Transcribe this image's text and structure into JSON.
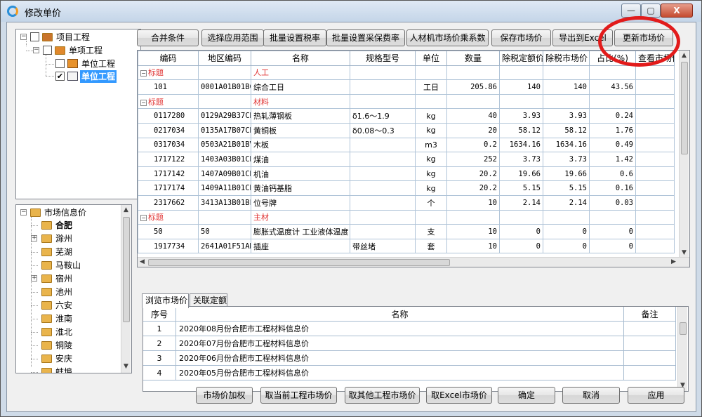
{
  "window": {
    "title": "修改单价",
    "min_glyph": "—",
    "max_glyph": "▢",
    "close_glyph": "X"
  },
  "project_tree": {
    "root": "项目工程",
    "child": "单项工程",
    "items": [
      "单位工程",
      "单位工程"
    ]
  },
  "market_tree": {
    "root": "市场信息价",
    "items": [
      "合肥",
      "滁州",
      "芜湖",
      "马鞍山",
      "宿州",
      "池州",
      "六安",
      "淮南",
      "淮北",
      "铜陵",
      "安庆",
      "蚌埠"
    ]
  },
  "toolbar": {
    "merge": "合并条件",
    "scope": "选择应用范围",
    "tax": "批量设置税率",
    "procure": "批量设置采保费率",
    "coef": "人材机市场价乘系数",
    "save": "保存市场价",
    "export": "导出到Excel",
    "update": "更新市场价"
  },
  "grid": {
    "headers": [
      "编码",
      "地区编码",
      "名称",
      "规格型号",
      "单位",
      "数量",
      "除税定额价",
      "除税市场价",
      "占比(%)",
      "查看市场价"
    ],
    "rows": [
      {
        "type": "cat",
        "code": "标题",
        "name": "人工"
      },
      {
        "type": "data",
        "code": "101",
        "region": "0001A01B01BC",
        "name": "综合工日",
        "spec": "",
        "unit": "工日",
        "qty": "205.86",
        "base": "140",
        "market": "140",
        "ratio": "43.56"
      },
      {
        "type": "cat",
        "code": "标题",
        "name": "材料"
      },
      {
        "type": "data",
        "code": "0117280",
        "region": "0129A29B37CB",
        "name": "热轧薄钢板",
        "spec": "δ1.6～1.9",
        "unit": "kg",
        "qty": "40",
        "base": "3.93",
        "market": "3.93",
        "ratio": "0.24"
      },
      {
        "type": "data",
        "code": "0217034",
        "region": "0135A17B07CB",
        "name": "黄铜板",
        "spec": "δ0.08～0.3",
        "unit": "kg",
        "qty": "20",
        "base": "58.12",
        "market": "58.12",
        "ratio": "1.76"
      },
      {
        "type": "data",
        "code": "0317034",
        "region": "0503A21B01BV",
        "name": "木板",
        "spec": "",
        "unit": "m3",
        "qty": "0.2",
        "base": "1634.16",
        "market": "1634.16",
        "ratio": "0.49"
      },
      {
        "type": "data",
        "code": "1717122",
        "region": "1403A03B01CB",
        "name": "煤油",
        "spec": "",
        "unit": "kg",
        "qty": "252",
        "base": "3.73",
        "market": "3.73",
        "ratio": "1.42"
      },
      {
        "type": "data",
        "code": "1717142",
        "region": "1407A09B01CB",
        "name": "机油",
        "spec": "",
        "unit": "kg",
        "qty": "20.2",
        "base": "19.66",
        "market": "19.66",
        "ratio": "0.6"
      },
      {
        "type": "data",
        "code": "1717174",
        "region": "1409A11B01CB",
        "name": "黄油钙基脂",
        "spec": "",
        "unit": "kg",
        "qty": "20.2",
        "base": "5.15",
        "market": "5.15",
        "ratio": "0.16"
      },
      {
        "type": "data",
        "code": "2317662",
        "region": "3413A13B01BF",
        "name": "位号牌",
        "spec": "",
        "unit": "个",
        "qty": "10",
        "base": "2.14",
        "market": "2.14",
        "ratio": "0.03"
      },
      {
        "type": "cat",
        "code": "标题",
        "name": "主材"
      },
      {
        "type": "data",
        "code": "50",
        "region": "50",
        "name": "膨胀式温度计 工业液体温度",
        "spec": "",
        "unit": "支",
        "qty": "10",
        "base": "0",
        "market": "0",
        "ratio": "0"
      },
      {
        "type": "data",
        "code": "1917734",
        "region": "2641A01F51AK",
        "name": "插座",
        "spec": "带丝堵",
        "unit": "套",
        "qty": "10",
        "base": "0",
        "market": "0",
        "ratio": "0"
      }
    ]
  },
  "tabs": {
    "browse": "浏览市场价",
    "related": "关联定额"
  },
  "market_list": {
    "headers": [
      "序号",
      "名称",
      "备注"
    ],
    "rows": [
      {
        "no": "1",
        "name": "2020年08月份合肥市工程材料信息价"
      },
      {
        "no": "2",
        "name": "2020年07月份合肥市工程材料信息价"
      },
      {
        "no": "3",
        "name": "2020年06月份合肥市工程材料信息价"
      },
      {
        "no": "4",
        "name": "2020年05月份合肥市工程材料信息价"
      }
    ]
  },
  "footer": {
    "weight": "市场价加权",
    "current": "取当前工程市场价",
    "other": "取其他工程市场价",
    "excel": "取Excel市场价",
    "ok": "确定",
    "cancel": "取消",
    "apply": "应用"
  },
  "colors": {
    "category_red": "#e03030",
    "selected_blue": "#3399ff",
    "annotation_red": "#e21b1b"
  }
}
